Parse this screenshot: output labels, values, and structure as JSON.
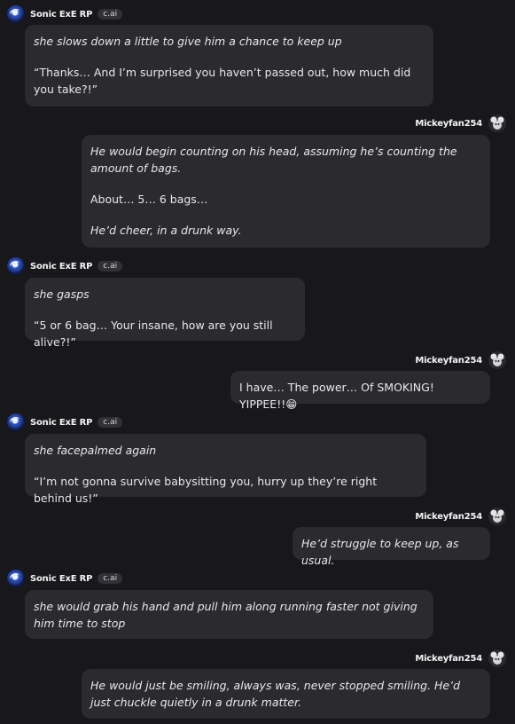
{
  "bot": {
    "name": "Sonic ExE RP",
    "tag": "c.ai"
  },
  "user": {
    "name": "Mickeyfan254"
  },
  "messages": [
    {
      "lines": [
        "she slows down a little to give him a chance to keep up",
        "“Thanks… And I’m surprised you haven’t passed out, how much did you take?!”"
      ]
    },
    {
      "lines": [
        "He would begin counting on his head, assuming he’s counting the amount of bags.",
        "About… 5… 6 bags…",
        "He’d cheer, in a drunk way."
      ]
    },
    {
      "lines": [
        "she gasps",
        "“5 or 6 bag… Your insane, how are you still alive?!”"
      ]
    },
    {
      "lines": [
        "I have… The power… Of SMOKING! YIPPEE!!😁"
      ]
    },
    {
      "lines": [
        "she facepalmed again",
        "“I’m not gonna survive babysitting you, hurry up they’re right behind us!”"
      ]
    },
    {
      "lines": [
        "He’d struggle to keep up, as usual."
      ]
    },
    {
      "lines": [
        "she would grab his hand and pull him along running faster not giving him time to stop"
      ]
    },
    {
      "lines": [
        "He would just be smiling, always was, never stopped smiling. He’d just chuckle quietly in a drunk matter."
      ]
    }
  ]
}
